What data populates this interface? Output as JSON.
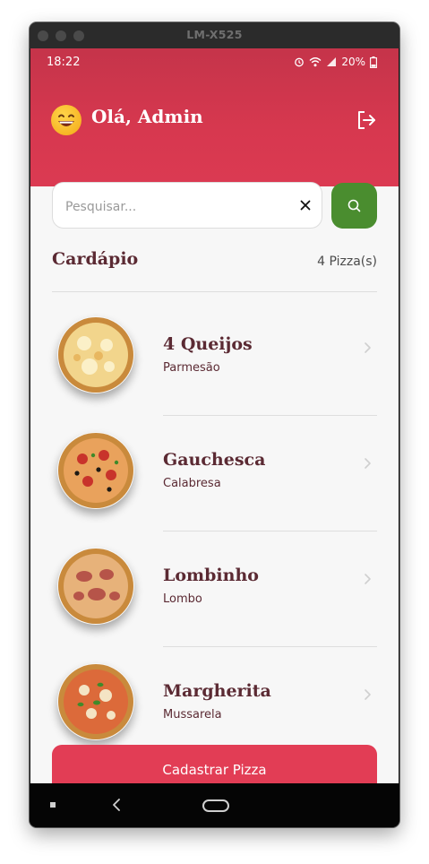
{
  "window": {
    "device_name": "LM-X525"
  },
  "status_bar": {
    "time": "18:22",
    "battery": "20%"
  },
  "header": {
    "greeting": "Olá, Admin"
  },
  "search": {
    "placeholder": "Pesquisar...",
    "value": ""
  },
  "menu": {
    "title": "Cardápio",
    "count": "4 Pizza(s)"
  },
  "pizzas": [
    {
      "name": "4 Queijos",
      "description": "Parmesão"
    },
    {
      "name": "Gauchesca",
      "description": "Calabresa"
    },
    {
      "name": "Lombinho",
      "description": "Lombo"
    },
    {
      "name": "Margherita",
      "description": "Mussarela"
    }
  ],
  "actions": {
    "register_label": "Cadastrar Pizza"
  },
  "colors": {
    "header": "#d7384f",
    "accent": "#e23d55",
    "search_button": "#4a8d2f",
    "title_text": "#5b2a33"
  }
}
